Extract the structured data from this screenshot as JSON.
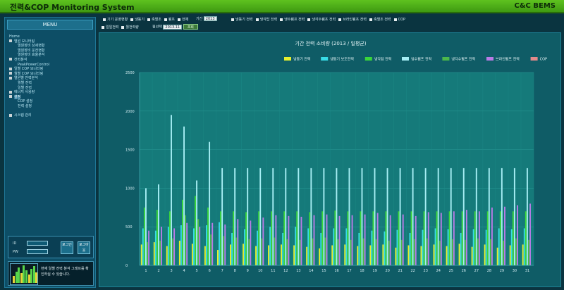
{
  "app": {
    "title": "전력&COP Monitoring System",
    "brand": "C&C BEMS"
  },
  "sidebar": {
    "header": "MENU",
    "tree": [
      {
        "label": "Home",
        "level": 0,
        "dot": false
      },
      {
        "label": "열원 모니터링",
        "level": 0,
        "dot": true
      },
      {
        "label": "열원장비 상세현황",
        "level": 1,
        "dot": false
      },
      {
        "label": "열원장비 운전현황",
        "level": 1,
        "dot": false
      },
      {
        "label": "열원장비 효율분석",
        "level": 1,
        "dot": false
      },
      {
        "label": "전력분석",
        "level": 0,
        "dot": true
      },
      {
        "label": "PeakPowerControl",
        "level": 1,
        "dot": false
      },
      {
        "label": "일별 COP 모니터링",
        "level": 0,
        "dot": true
      },
      {
        "label": "월별 COP 모니터링",
        "level": 0,
        "dot": true
      },
      {
        "label": "열원별 전력분석",
        "level": 0,
        "dot": true
      },
      {
        "label": "월별 전력",
        "level": 1,
        "dot": false
      },
      {
        "label": "일별 전력",
        "level": 1,
        "dot": false
      },
      {
        "label": "에너지 사용량",
        "level": 0,
        "dot": true
      },
      {
        "label": "설정",
        "level": 0,
        "dot": true,
        "selected": true
      },
      {
        "label": "COP 설정",
        "level": 1,
        "dot": false
      },
      {
        "label": "전력 설정",
        "level": 1,
        "dot": false
      },
      {
        "label": "",
        "level": 0,
        "dot": false
      },
      {
        "label": "시스템 관리",
        "level": 0,
        "dot": true
      }
    ],
    "inputs": {
      "id_label": "ID",
      "pw_label": "PW",
      "login_label": "로그인",
      "logout_label": "로그아웃"
    },
    "thumbnail": {
      "text": "현재 일별 전력 분석 그래프를 확인하실 수 있습니다."
    }
  },
  "filters": {
    "row1": [
      "기기 운영현황",
      "냉동기",
      "축열조",
      "펌프",
      "전체"
    ],
    "period_label": "기간",
    "period_value": "2013",
    "row1_more": [
      "냉동기 전력",
      "냉각탑 전력",
      "냉수펌프 전력",
      "냉각수펌프 전력",
      "브라인펌프 전력",
      "축열조 전력",
      "COP"
    ],
    "row2": [
      "일일전력",
      "월전력량"
    ],
    "month_label": "월선택",
    "month_value": "2013.11",
    "search_label": "조회"
  },
  "chart_data": {
    "type": "bar",
    "title": "기간 전력 소비량 (2013 / 일평균)",
    "categories": [
      "1",
      "2",
      "3",
      "4",
      "5",
      "6",
      "7",
      "8",
      "9",
      "10",
      "11",
      "12",
      "13",
      "14",
      "15",
      "16",
      "17",
      "18",
      "19",
      "20",
      "21",
      "22",
      "23",
      "24",
      "25",
      "26",
      "27",
      "28",
      "29",
      "30",
      "31"
    ],
    "ylim": [
      0,
      2500
    ],
    "yticks": [
      "0",
      "500",
      "1000",
      "1500",
      "2000",
      "2500"
    ],
    "series": [
      {
        "name": "냉동기 전력",
        "color": "#e8ef2e",
        "values": [
          270,
          300,
          250,
          320,
          280,
          250,
          200,
          270,
          280,
          250,
          260,
          270,
          260,
          240,
          220,
          260,
          270,
          250,
          260,
          270,
          230,
          260,
          250,
          270,
          250,
          280,
          240,
          270,
          230,
          260,
          270
        ]
      },
      {
        "name": "냉동기 보조전력",
        "color": "#38dbe6",
        "values": [
          480,
          450,
          500,
          520,
          480,
          520,
          560,
          420,
          470,
          450,
          500,
          420,
          500,
          480,
          420,
          480,
          480,
          420,
          450,
          440,
          460,
          420,
          460,
          480,
          470,
          420,
          470,
          460,
          480,
          470,
          480
        ]
      },
      {
        "name": "냉각탑 전력",
        "color": "#3ad63a",
        "values": [
          750,
          720,
          700,
          850,
          900,
          750,
          700,
          700,
          690,
          700,
          700,
          700,
          700,
          690,
          700,
          710,
          700,
          700,
          700,
          700,
          700,
          700,
          700,
          700,
          700,
          700,
          700,
          700,
          700,
          700,
          700
        ]
      },
      {
        "name": "냉수펌프 전력",
        "color": "#a6eef4",
        "values": [
          1000,
          1050,
          1950,
          1800,
          1100,
          1600,
          1260,
          1260,
          1260,
          1260,
          1260,
          1260,
          1260,
          1260,
          1260,
          1260,
          1260,
          1260,
          1260,
          1260,
          1260,
          1260,
          1260,
          1260,
          1260,
          1260,
          1260,
          1260,
          1260,
          1260,
          1260
        ]
      },
      {
        "name": "냉각수펌프 전력",
        "color": "#4cb84b",
        "values": [
          300,
          320,
          350,
          650,
          600,
          400,
          380,
          360,
          340,
          350,
          360,
          340,
          330,
          350,
          360,
          340,
          330,
          350,
          340,
          320,
          330,
          340,
          350,
          320,
          340,
          330,
          350,
          340,
          320,
          350,
          330
        ]
      },
      {
        "name": "브라인펌프 전력",
        "color": "#b97be6",
        "values": [
          450,
          500,
          480,
          550,
          500,
          550,
          530,
          600,
          580,
          620,
          650,
          640,
          630,
          650,
          660,
          640,
          650,
          660,
          680,
          650,
          660,
          640,
          690,
          680,
          700,
          720,
          700,
          750,
          760,
          780,
          800
        ]
      },
      {
        "name": "COP",
        "color": "#e38a8a",
        "values": [
          0,
          0,
          0,
          0,
          0,
          0,
          0,
          0,
          0,
          0,
          0,
          0,
          0,
          0,
          0,
          0,
          0,
          0,
          0,
          0,
          0,
          0,
          0,
          0,
          0,
          0,
          0,
          0,
          0,
          0,
          0
        ]
      }
    ],
    "legend_position": "top-right",
    "grid": true
  }
}
